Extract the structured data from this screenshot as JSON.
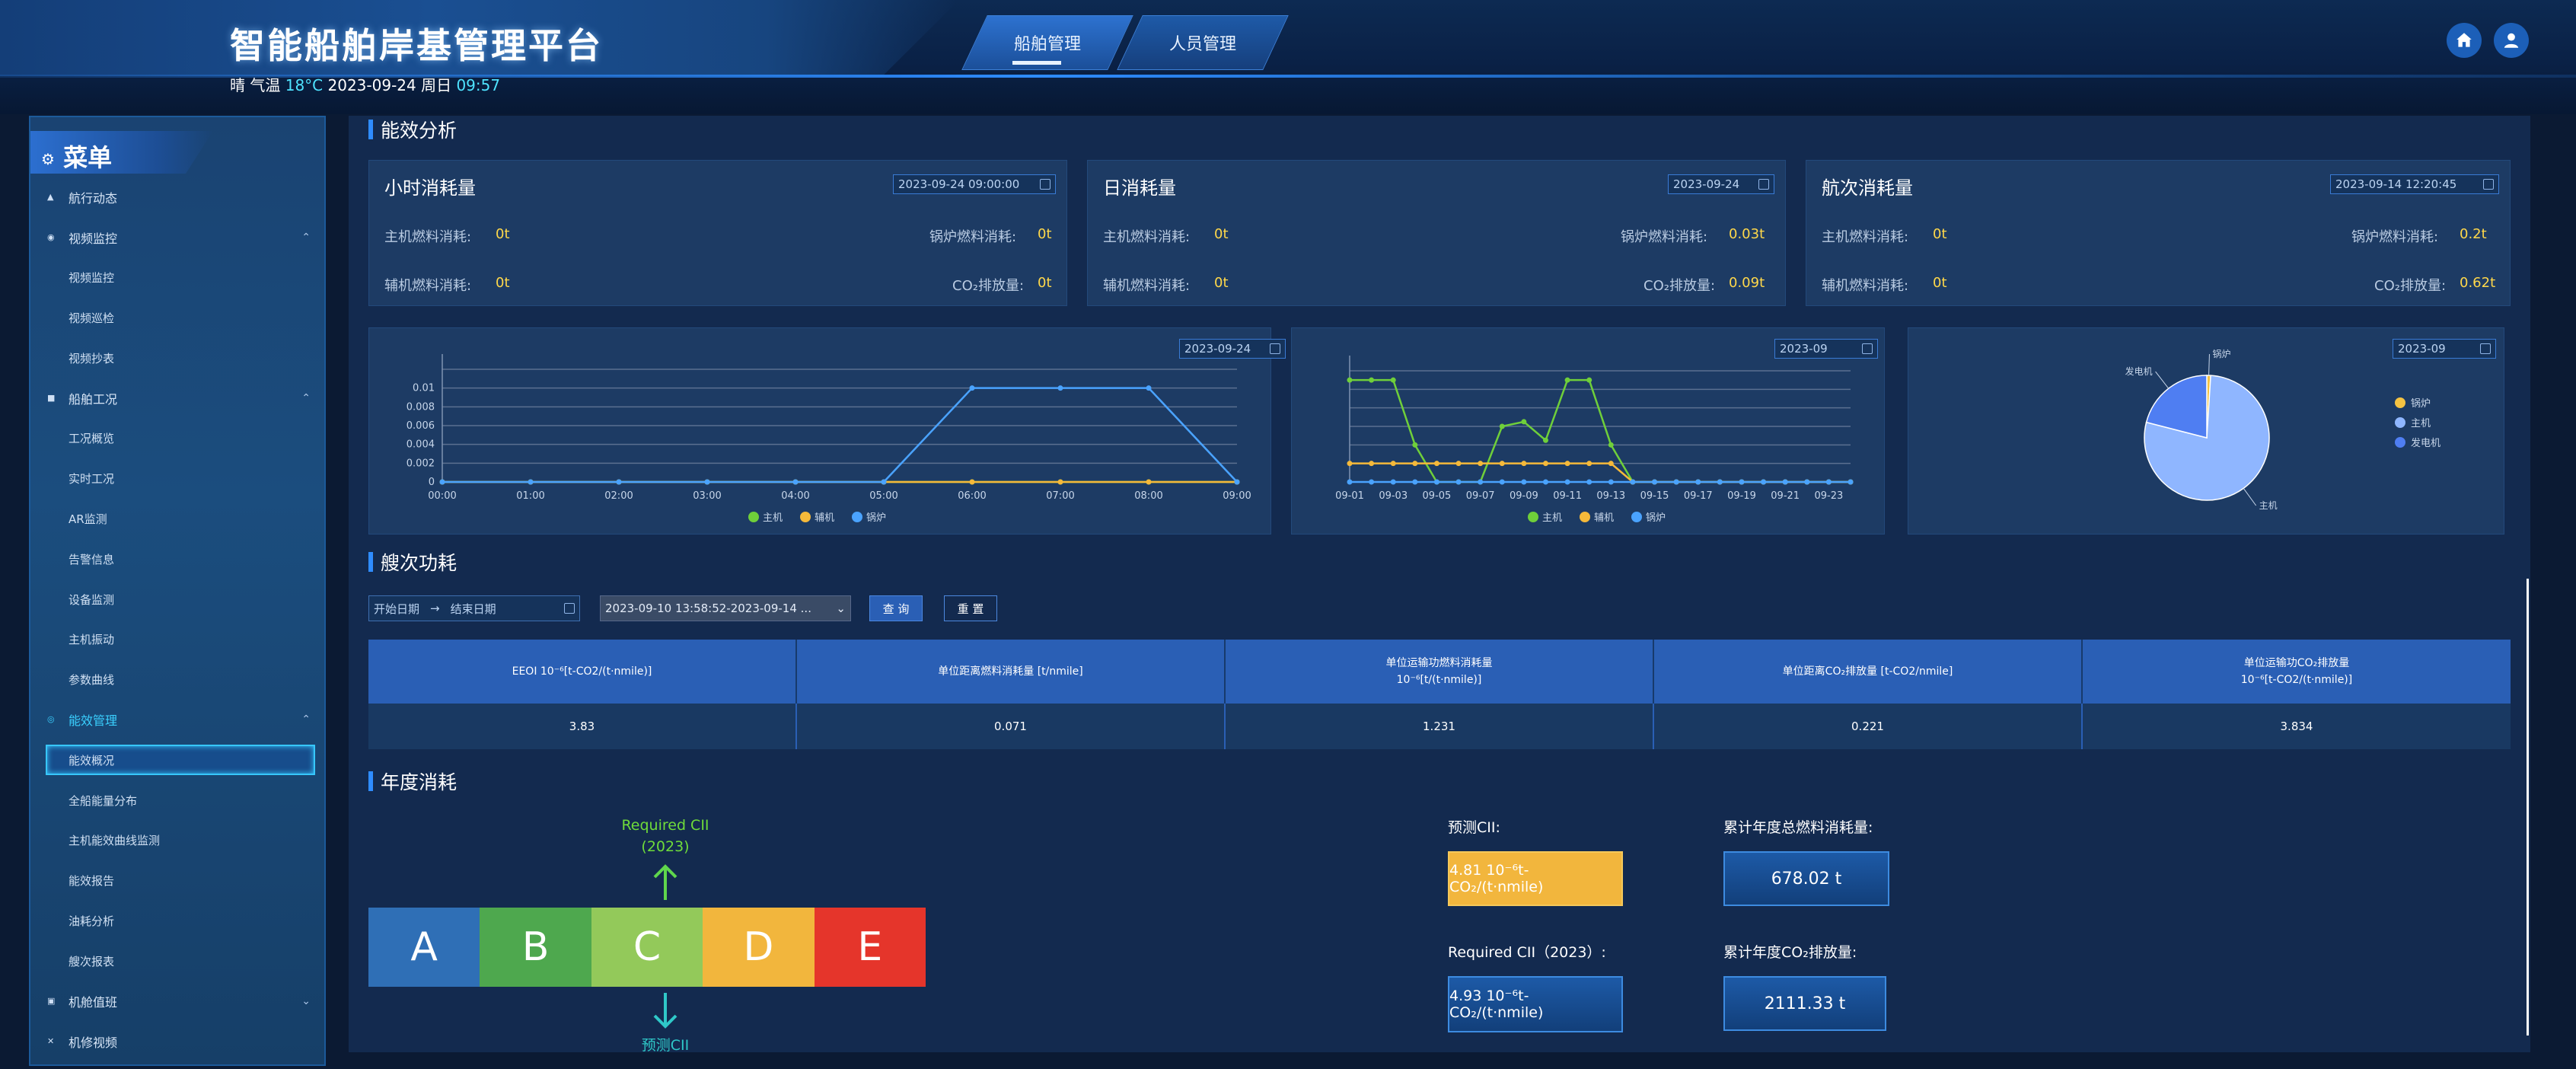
{
  "header": {
    "title": "智能船舶岸基管理平台",
    "weather": {
      "condition": "晴 气温",
      "temp": "18°C",
      "date": "2023-09-24 周日",
      "time": "09:57"
    },
    "tabs": [
      {
        "label": "船舶管理",
        "active": true
      },
      {
        "label": "人员管理",
        "active": false
      }
    ],
    "icons": [
      "home-icon",
      "user-icon"
    ]
  },
  "sidebar": {
    "title": "菜单",
    "items": [
      {
        "type": "item",
        "label": "航行动态",
        "icon": "location-icon"
      },
      {
        "type": "group",
        "label": "视频监控",
        "icon": "video-icon",
        "expanded": true
      },
      {
        "type": "sub",
        "label": "视频监控"
      },
      {
        "type": "sub",
        "label": "视频巡检"
      },
      {
        "type": "sub",
        "label": "视频抄表"
      },
      {
        "type": "group",
        "label": "船舶工况",
        "icon": "ship-icon",
        "expanded": true
      },
      {
        "type": "sub",
        "label": "工况概览"
      },
      {
        "type": "sub",
        "label": "实时工况"
      },
      {
        "type": "sub",
        "label": "AR监测"
      },
      {
        "type": "sub",
        "label": "告警信息"
      },
      {
        "type": "sub",
        "label": "设备监测"
      },
      {
        "type": "sub",
        "label": "主机振动"
      },
      {
        "type": "sub",
        "label": "参数曲线"
      },
      {
        "type": "group",
        "label": "能效管理",
        "icon": "energy-icon",
        "expanded": true,
        "highlight": true
      },
      {
        "type": "sub",
        "label": "能效概况",
        "active": true
      },
      {
        "type": "sub",
        "label": "全船能量分布"
      },
      {
        "type": "sub",
        "label": "主机能效曲线监测"
      },
      {
        "type": "sub",
        "label": "能效报告"
      },
      {
        "type": "sub",
        "label": "油耗分析"
      },
      {
        "type": "sub",
        "label": "艘次报表"
      },
      {
        "type": "group",
        "label": "机舱值班",
        "icon": "duty-icon",
        "expanded": false
      },
      {
        "type": "item",
        "label": "机修视频",
        "icon": "tools-icon"
      }
    ]
  },
  "energy_analysis": {
    "title": "能效分析",
    "cards": [
      {
        "title": "小时消耗量",
        "date": "2023-09-24 09:00:00",
        "rows": [
          [
            "主机燃料消耗:",
            "0t",
            "锅炉燃料消耗:",
            "0t"
          ],
          [
            "辅机燃料消耗:",
            "0t",
            "CO₂排放量:",
            "0t"
          ]
        ]
      },
      {
        "title": "日消耗量",
        "date": "2023-09-24",
        "rows": [
          [
            "主机燃料消耗:",
            "0t",
            "锅炉燃料消耗:",
            "0.03t"
          ],
          [
            "辅机燃料消耗:",
            "0t",
            "CO₂排放量:",
            "0.09t"
          ]
        ]
      },
      {
        "title": "航次消耗量",
        "date": "2023-09-14 12:20:45",
        "rows": [
          [
            "主机燃料消耗:",
            "0t",
            "锅炉燃料消耗:",
            "0.2t"
          ],
          [
            "辅机燃料消耗:",
            "0t",
            "CO₂排放量:",
            "0.62t"
          ]
        ]
      }
    ]
  },
  "charts": {
    "hourly": {
      "date": "2023-09-24"
    },
    "daily": {
      "date": "2023-09"
    },
    "pie": {
      "date": "2023-09"
    }
  },
  "chart_data": [
    {
      "type": "line",
      "x": [
        "00:00",
        "01:00",
        "02:00",
        "03:00",
        "04:00",
        "05:00",
        "06:00",
        "07:00",
        "08:00",
        "09:00"
      ],
      "ylim": [
        0,
        0.012
      ],
      "yticks": [
        "0",
        "0.002",
        "0.004",
        "0.006",
        "0.008",
        "0.01"
      ],
      "series": [
        {
          "name": "主机",
          "color": "#6fcf3a",
          "values": [
            0,
            0,
            0,
            0,
            0,
            0,
            0,
            0,
            0,
            0
          ]
        },
        {
          "name": "辅机",
          "color": "#f5b93a",
          "values": [
            0,
            0,
            0,
            0,
            0,
            0,
            0,
            0,
            0,
            0
          ]
        },
        {
          "name": "锅炉",
          "color": "#4aa3ff",
          "values": [
            0,
            0,
            0,
            0,
            0,
            0,
            0.01,
            0.01,
            0.01,
            0
          ]
        }
      ],
      "legend": "bottom"
    },
    {
      "type": "line",
      "x": [
        "09-01",
        "09-02",
        "09-03",
        "09-04",
        "09-05",
        "09-06",
        "09-07",
        "09-08",
        "09-09",
        "09-10",
        "09-11",
        "09-12",
        "09-13",
        "09-14",
        "09-15",
        "09-16",
        "09-17",
        "09-18",
        "09-19",
        "09-20",
        "09-21",
        "09-22",
        "09-23",
        "09-24"
      ],
      "xticks": [
        "09-01",
        "09-03",
        "09-05",
        "09-07",
        "09-09",
        "09-11",
        "09-13",
        "09-15",
        "09-17",
        "09-19",
        "09-21",
        "09-23"
      ],
      "ylim": [
        0,
        12
      ],
      "series": [
        {
          "name": "主机",
          "color": "#6fcf3a",
          "values": [
            11,
            11,
            11,
            4,
            0,
            0,
            0,
            6,
            6.5,
            4.5,
            11,
            11,
            4,
            0,
            0,
            0,
            0,
            0,
            0,
            0,
            0,
            0,
            0,
            0
          ]
        },
        {
          "name": "辅机",
          "color": "#f5b93a",
          "values": [
            2,
            2,
            2,
            2,
            2,
            2,
            2,
            2,
            2,
            2,
            2,
            2,
            2,
            0,
            0,
            0,
            0,
            0,
            0,
            0,
            0,
            0,
            0,
            0
          ]
        },
        {
          "name": "锅炉",
          "color": "#4aa3ff",
          "values": [
            0,
            0,
            0,
            0,
            0,
            0,
            0,
            0,
            0,
            0,
            0,
            0,
            0,
            0,
            0,
            0,
            0,
            0,
            0,
            0,
            0,
            0,
            0,
            0
          ]
        }
      ],
      "legend": "bottom"
    },
    {
      "type": "pie",
      "slices": [
        {
          "name": "锅炉",
          "value": 1,
          "color": "#f5c342",
          "label": "锅炉"
        },
        {
          "name": "主机",
          "value": 78,
          "color": "#8fb6ff",
          "label": "主机"
        },
        {
          "name": "发电机",
          "value": 21,
          "color": "#4f7ef2",
          "label": "发电机"
        }
      ],
      "legend": "right"
    }
  ],
  "voyage": {
    "title": "艘次功耗",
    "start_placeholder": "开始日期",
    "end_placeholder": "结束日期",
    "range_value": "2023-09-10 13:58:52-2023-09-14 ...",
    "query_label": "查 询",
    "reset_label": "重 置",
    "headers": [
      "EEOI 10⁻⁶[t-CO2/(t·nmile)]",
      "单位距离燃料消耗量 [t/nmile]",
      "单位运输功燃料消耗量\n10⁻⁶[t/(t·nmile)]",
      "单位距离CO₂排放量 [t-CO2/nmile]",
      "单位运输功CO₂排放量\n10⁻⁶[t-CO2/(t·nmile)]"
    ],
    "values": [
      "3.83",
      "0.071",
      "1.231",
      "0.221",
      "3.834"
    ]
  },
  "annual": {
    "title": "年度消耗",
    "required_label_1": "Required CII",
    "required_label_2": "(2023)",
    "predicted_label": "预测CII",
    "grades": [
      {
        "letter": "A",
        "color": "#2f6fb6"
      },
      {
        "letter": "B",
        "color": "#4ea84e"
      },
      {
        "letter": "C",
        "color": "#93c95a"
      },
      {
        "letter": "D",
        "color": "#f2b63d"
      },
      {
        "letter": "E",
        "color": "#e5352b"
      }
    ],
    "predicted_cii_label": "预测CII:",
    "predicted_cii_value": "4.81 10⁻⁶t-CO₂/(t·nmile)",
    "required_cii_label": "Required CII（2023）:",
    "required_cii_value": "4.93 10⁻⁶t-CO₂/(t·nmile)",
    "fuel_label": "累计年度总燃料消耗量:",
    "fuel_value": "678.02 t",
    "co2_label": "累计年度CO₂排放量:",
    "co2_value": "2111.33 t",
    "predicted_box_color": "#f2b63d"
  }
}
